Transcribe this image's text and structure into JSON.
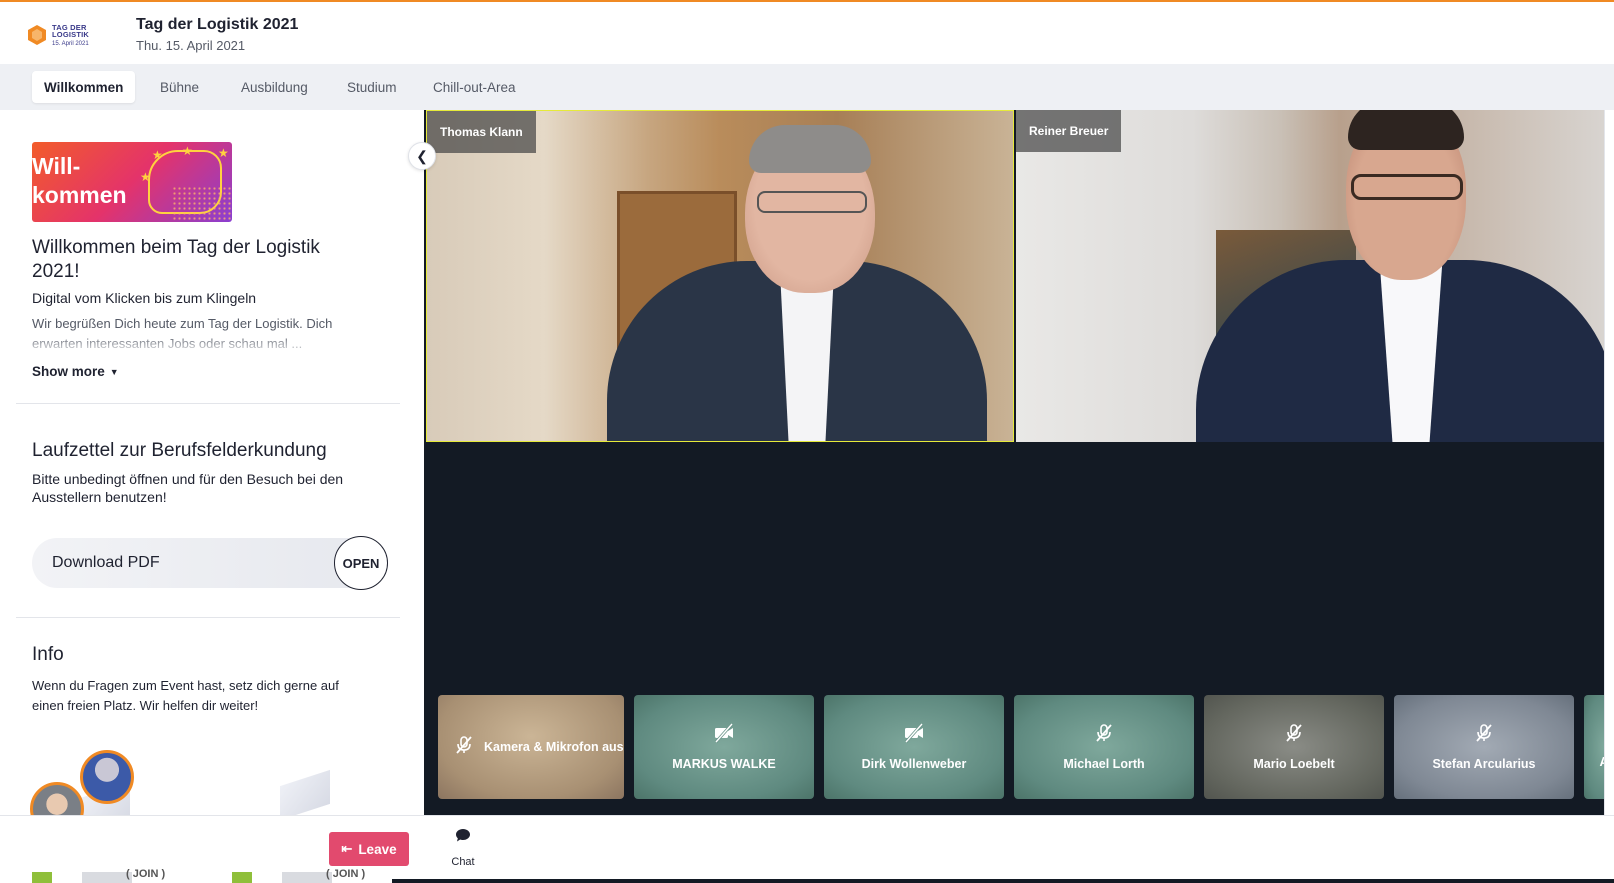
{
  "header": {
    "logo_line1": "TAG DER LOGISTIK",
    "logo_line2": "15. April 2021",
    "title": "Tag der Logistik 2021",
    "date": "Thu. 15. April 2021"
  },
  "tabs": [
    {
      "label": "Willkommen",
      "active": true
    },
    {
      "label": "Bühne"
    },
    {
      "label": "Ausbildung"
    },
    {
      "label": "Studium"
    },
    {
      "label": "Chill-out-Area"
    }
  ],
  "sidebar": {
    "banner_line1": "Will-",
    "banner_line2": "kommen",
    "welcome_title": "Willkommen beim Tag der Logistik 2021!",
    "welcome_subtitle": "Digital vom Klicken bis zum Klingeln",
    "welcome_description": "Wir begrüßen Dich heute zum Tag der Logistik. Dich erwarten interessanten Jobs oder schau mal ...",
    "show_more": "Show more",
    "laufzettel_title": "Laufzettel zur Berufsfelderkundung",
    "laufzettel_description": "Bitte unbedingt öffnen und für den Besuch bei den Ausstellern benutzen!",
    "pdf_label": "Download PDF",
    "pdf_button": "OPEN",
    "info_title": "Info",
    "info_description": "Wenn du Fragen zum Event hast, setz dich gerne auf einen freien Platz. Wir helfen dir weiter!",
    "peek_join_1": "( JOIN )",
    "peek_join_2": "( JOIN )"
  },
  "stage": {
    "speakers": [
      {
        "name": "Thomas Klann",
        "active_speaker": true
      },
      {
        "name": "Reiner Breuer"
      }
    ],
    "participants": [
      {
        "name": "Kamera & Mikrofon aus",
        "icon": "mic-off-icon",
        "self": true
      },
      {
        "name": "MARKUS WALKE",
        "icon": "video-off-icon"
      },
      {
        "name": "Dirk Wollenweber",
        "icon": "video-off-icon"
      },
      {
        "name": "Michael Lorth",
        "icon": "mic-off-icon"
      },
      {
        "name": "Mario Loebelt",
        "icon": "mic-off-icon"
      },
      {
        "name": "Stefan Arcularius",
        "icon": "mic-off-icon"
      },
      {
        "name": "A",
        "icon": "mic-off-icon"
      }
    ]
  },
  "bottombar": {
    "leave_label": "Leave",
    "chat_label": "Chat"
  },
  "colors": {
    "accent_orange": "#f08a24",
    "leave_red": "#e24a6e",
    "stage_bg": "#131a24",
    "active_speaker_border": "#e6ea3a"
  }
}
